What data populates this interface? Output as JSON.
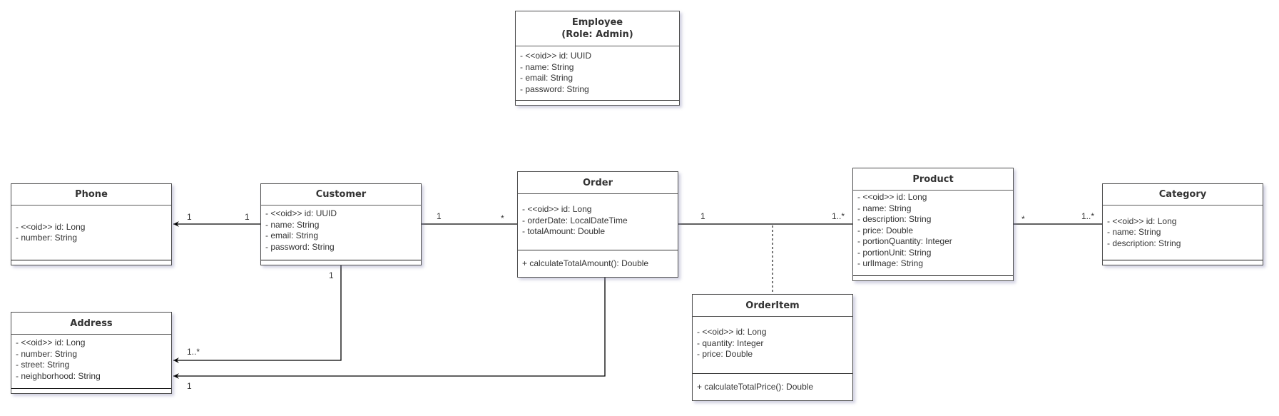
{
  "diagram": {
    "type": "UML class diagram",
    "classes": {
      "employee": {
        "name": "Employee\n(Role: Admin)",
        "attributes": [
          "- <<oid>> id: UUID",
          "- name: String",
          "- email: String",
          "- password: String"
        ],
        "operations": []
      },
      "phone": {
        "name": "Phone",
        "attributes": [
          "- <<oid>> id: Long",
          "- number: String"
        ],
        "operations": []
      },
      "customer": {
        "name": "Customer",
        "attributes": [
          "- <<oid>> id: UUID",
          "- name: String",
          "- email: String",
          "- password: String"
        ],
        "operations": []
      },
      "order": {
        "name": "Order",
        "attributes": [
          "- <<oid>> id: Long",
          "- orderDate: LocalDateTime",
          "- totalAmount: Double"
        ],
        "operations": [
          "+ calculateTotalAmount(): Double"
        ]
      },
      "product": {
        "name": "Product",
        "attributes": [
          "- <<oid>> id: Long",
          "- name: String",
          "- description: String",
          "- price: Double",
          "- portionQuantity: Integer",
          "- portionUnit: String",
          "- urlImage: String"
        ],
        "operations": []
      },
      "category": {
        "name": "Category",
        "attributes": [
          "- <<oid>> id: Long",
          "- name: String",
          "- description: String"
        ],
        "operations": []
      },
      "address": {
        "name": "Address",
        "attributes": [
          "- <<oid>> id: Long",
          "- number: String",
          "- street: String",
          "- neighborhood: String"
        ],
        "operations": []
      },
      "orderitem": {
        "name": "OrderItem",
        "attributes": [
          "- <<oid>> id: Long",
          "- quantity: Integer",
          "- price: Double"
        ],
        "operations": [
          "+ calculateTotalPrice(): Double"
        ]
      }
    },
    "associations": [
      {
        "from": "Customer",
        "to": "Phone",
        "from_mult": "1",
        "to_mult": "1",
        "navigable_to": true
      },
      {
        "from": "Customer",
        "to": "Order",
        "from_mult": "1",
        "to_mult": "*",
        "navigable_to": false
      },
      {
        "from": "Order",
        "to": "Product",
        "from_mult": "1",
        "to_mult": "1..*",
        "navigable_to": false,
        "association_class": "OrderItem"
      },
      {
        "from": "Product",
        "to": "Category",
        "from_mult": "*",
        "to_mult": "1..*",
        "navigable_to": false
      },
      {
        "from": "Customer",
        "to": "Address",
        "from_mult": "1",
        "to_mult": "1..*",
        "navigable_to": true
      },
      {
        "from": "Order",
        "to": "Address",
        "from_mult": "",
        "to_mult": "1",
        "navigable_to": true
      }
    ],
    "multiplicity_labels": {
      "phone_end": "1",
      "customer_phone_end": "1",
      "customer_order_end": "1",
      "order_customer_end": "*",
      "order_product_end": "1",
      "product_order_end": "1..*",
      "product_category_end": "*",
      "category_end": "1..*",
      "customer_address_end": "1",
      "address_customer_end": "1..*",
      "address_order_end": "1"
    }
  }
}
